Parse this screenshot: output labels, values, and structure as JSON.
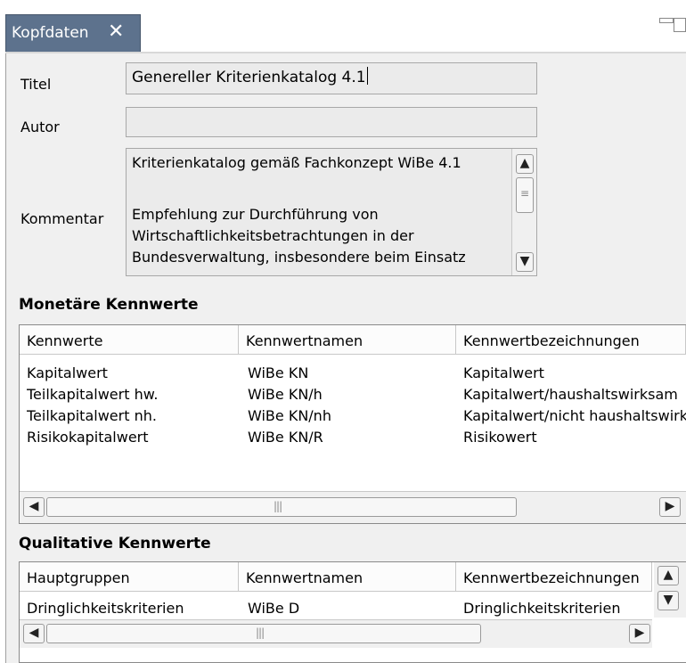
{
  "tab": {
    "label": "Kopfdaten",
    "close": "✕"
  },
  "form": {
    "title_label": "Titel",
    "title_value": "Genereller Kriterienkatalog 4.1",
    "author_label": "Autor",
    "author_value": "",
    "comment_label": "Kommentar",
    "comment_lines": [
      "Kriterienkatalog gemäß Fachkonzept WiBe 4.1",
      "",
      "Empfehlung zur Durchführung von",
      "Wirtschaftlichkeitsbetrachtungen in der",
      "Bundesverwaltung, insbesondere beim Einsatz"
    ]
  },
  "monetary": {
    "title": "Monetäre Kennwerte",
    "columns": [
      "Kennwerte",
      "Kennwertnamen",
      "Kennwertbezeichnungen"
    ],
    "rows": [
      [
        "Kapitalwert",
        "WiBe KN",
        "Kapitalwert"
      ],
      [
        "Teilkapitalwert hw.",
        "WiBe KN/h",
        "Kapitalwert/haushaltswirksam"
      ],
      [
        "Teilkapitalwert nh.",
        "WiBe KN/nh",
        "Kapitalwert/nicht haushaltswirksam"
      ],
      [
        "Risikokapitalwert",
        "WiBe KN/R",
        "Risikowert"
      ]
    ]
  },
  "qualitative": {
    "title": "Qualitative Kennwerte",
    "columns": [
      "Hauptgruppen",
      "Kennwertnamen",
      "Kennwertbezeichnungen"
    ],
    "rows": [
      [
        "Dringlichkeitskriterien",
        "WiBe D",
        "Dringlichkeitskriterien"
      ]
    ]
  },
  "icons": {
    "scroll_up": "chevron-up-icon",
    "scroll_down": "chevron-down-icon",
    "scroll_left": "chevron-left-icon",
    "scroll_right": "chevron-right-icon",
    "minimize": "minimize-icon",
    "maximize": "maximize-icon"
  },
  "colors": {
    "tab_active": "#5d728d",
    "panel_bg": "#f0f0f0"
  }
}
